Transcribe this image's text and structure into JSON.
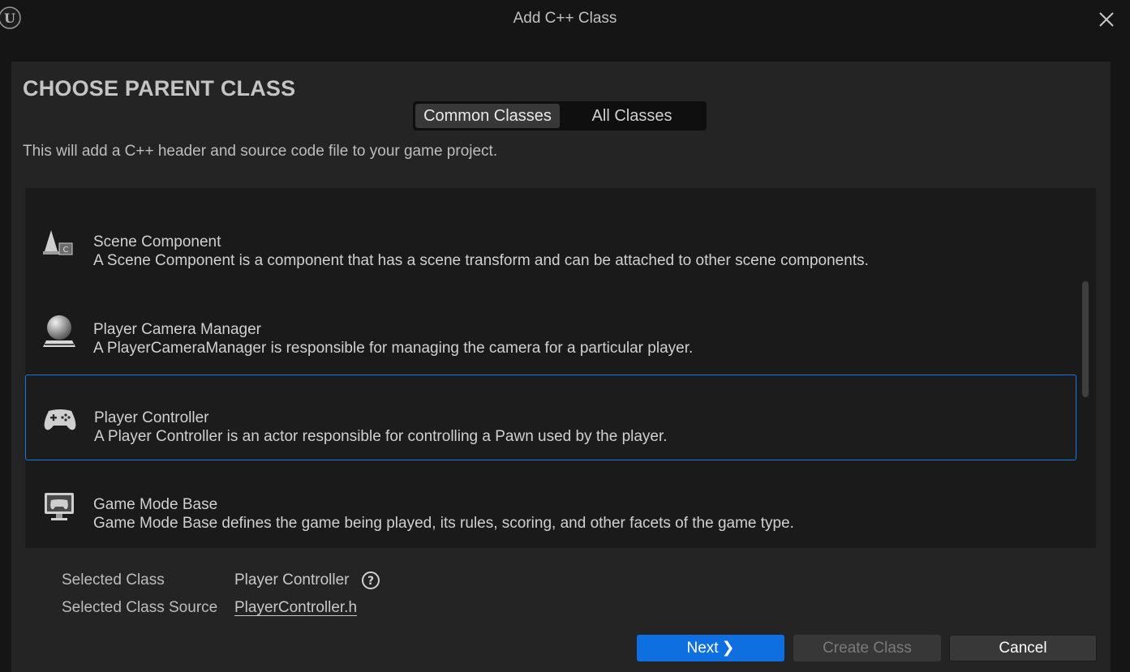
{
  "window": {
    "title": "Add C++ Class"
  },
  "dialog": {
    "heading": "CHOOSE PARENT CLASS",
    "description": "This will add a C++ header and source code file to your game project.",
    "tabs": [
      {
        "label": "Common Classes",
        "active": true
      },
      {
        "label": "All Classes",
        "active": false
      }
    ]
  },
  "classes": [
    {
      "name": "Scene Component",
      "description": "A Scene Component is a component that has a scene transform and can be attached to other scene components.",
      "icon": "scene-component-icon",
      "selected": false
    },
    {
      "name": "Player Camera Manager",
      "description": "A PlayerCameraManager is responsible for managing the camera for a particular player.",
      "icon": "camera-manager-icon",
      "selected": false
    },
    {
      "name": "Player Controller",
      "description": "A Player Controller is an actor responsible for controlling a Pawn used by the player.",
      "icon": "gamepad-icon",
      "selected": true
    },
    {
      "name": "Game Mode Base",
      "description": "Game Mode Base defines the game being played, its rules, scoring, and other facets of the game type.",
      "icon": "game-mode-icon",
      "selected": false
    }
  ],
  "selection": {
    "class_label": "Selected Class",
    "class_value": "Player Controller",
    "source_label": "Selected Class Source",
    "source_value": "PlayerController.h"
  },
  "buttons": {
    "next": "Next",
    "create": "Create Class",
    "cancel": "Cancel"
  },
  "colors": {
    "accent": "#0e70e0",
    "selected_border": "#0e7ae6"
  }
}
